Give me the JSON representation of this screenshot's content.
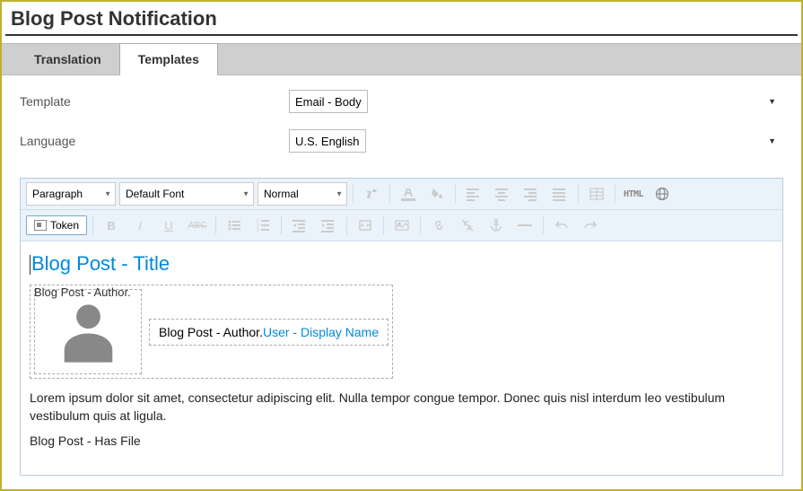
{
  "page": {
    "title": "Blog Post Notification"
  },
  "tabs": {
    "translation": "Translation",
    "templates": "Templates"
  },
  "form": {
    "template_label": "Template",
    "template_value": "Email - Body",
    "language_label": "Language",
    "language_value": "U.S. English"
  },
  "toolbar": {
    "paragraph": "Paragraph",
    "font": "Default Font",
    "size": "Normal",
    "token": "Token",
    "html": "HTML"
  },
  "editor": {
    "title_token": "Blog Post - Title",
    "author_token_label": "Blog Post - Author.",
    "author_name_prefix": "Blog Post - Author.",
    "author_name_link": "User - Display Name",
    "body_text": "Lorem ipsum dolor sit amet, consectetur adipiscing elit. Nulla tempor congue tempor. Donec quis nisl interdum leo vestibulum vestibulum quis at ligula.",
    "hasfile_token": "Blog Post - Has File"
  }
}
